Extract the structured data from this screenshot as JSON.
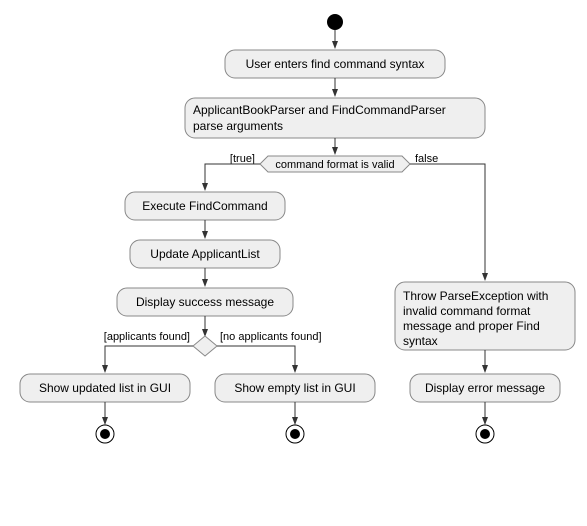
{
  "chart_data": {
    "type": "activity-diagram",
    "nodes": {
      "start": {
        "type": "start"
      },
      "enter": {
        "type": "activity",
        "label": "User enters find command syntax"
      },
      "parse": {
        "type": "activity",
        "label_l1": "ApplicantBookParser and FindCommandParser",
        "label_l2": "parse arguments"
      },
      "decision1": {
        "type": "decision",
        "label": "command format is valid",
        "branches": {
          "true": "[true]",
          "false": "false"
        }
      },
      "execute": {
        "type": "activity",
        "label": "Execute FindCommand"
      },
      "update": {
        "type": "activity",
        "label": "Update ApplicantList"
      },
      "success": {
        "type": "activity",
        "label": "Display success message"
      },
      "decision2": {
        "type": "decision",
        "branches": {
          "found": "[applicants found]",
          "notfound": "[no applicants found]"
        }
      },
      "showlist": {
        "type": "activity",
        "label": "Show updated list in GUI"
      },
      "showempty": {
        "type": "activity",
        "label": "Show empty list in GUI"
      },
      "throw": {
        "type": "activity",
        "label_l1": "Throw ParseException with",
        "label_l2": "invalid command format",
        "label_l3": "message and proper Find",
        "label_l4": "syntax"
      },
      "error": {
        "type": "activity",
        "label": "Display error message"
      },
      "end1": {
        "type": "end"
      },
      "end2": {
        "type": "end"
      },
      "end3": {
        "type": "end"
      }
    }
  }
}
